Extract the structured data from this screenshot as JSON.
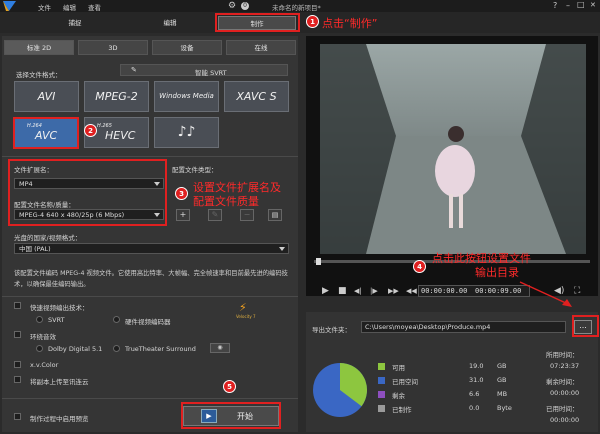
{
  "menu": {
    "file": "文件",
    "edit": "编辑",
    "view": "查看"
  },
  "window": {
    "title": "未命名的新项目*",
    "help": "?",
    "minimize": "–",
    "maximize": "□",
    "close": "✕"
  },
  "modes": {
    "capture": "捕捉",
    "edit": "编辑",
    "produce": "制作"
  },
  "subtabs": {
    "standard2d": "标准 2D",
    "threed": "3D",
    "device": "设备",
    "online": "在线"
  },
  "format_section": {
    "label": "选择文件格式：",
    "smart_svrt": "智能 SVRT"
  },
  "formats": {
    "avi": "AVI",
    "mpeg2": "MPEG-2",
    "wmv": "Windows Media",
    "xavc": "XAVC S",
    "avc_top": "H.264",
    "avc": "AVC",
    "hevc_top": "H.265",
    "hevc": "HEVC",
    "audio": "♪♪"
  },
  "settings": {
    "ext_label": "文件扩展名：",
    "ext_value": "MP4",
    "profile_label": "配置文件名称/质量：",
    "profile_value": "MPEG-4 640 x 480/25p (6 Mbps)",
    "profile_type_label": "配置文件类型：",
    "plus": "+",
    "region_label": "光盘的国家/视频格式：",
    "region_value": "中国 (PAL)",
    "desc": "该配置文件编码 MPEG-4 视频文件。它使用高比特率、大帧幅、完全帧速率和目前最先进的编码技术，以确保最佳编码输出。"
  },
  "encode": {
    "fast_label": "快速视频编出技术：",
    "svrt": "SVRT",
    "hw": "硬件视频编码器",
    "surround_label": "环绕音效",
    "dolby": "Dolby Digital 5.1",
    "truetheater": "TrueTheater Surround",
    "xvcolor": "x.v.Color",
    "upload": "将副本上传至讯连云",
    "preview_during": "制作过程中启用预览",
    "velocity": "Velocity 7"
  },
  "start_label": "开始",
  "player": {
    "time_current": "00:00:00.00",
    "time_total": "00:00:09.00"
  },
  "output": {
    "folder_label": "导出文件夹：",
    "path": "C:\\Users\\moyea\\Desktop\\Produce.mp4",
    "browse": "...",
    "disk": [
      {
        "label": "可用",
        "value": "19.0",
        "unit": "GB",
        "color": "#8dc63f"
      },
      {
        "label": "已用空间",
        "value": "31.0",
        "unit": "GB",
        "color": "#3a67c4"
      },
      {
        "label": "剩余",
        "value": "6.6",
        "unit": "MB",
        "color": "#8e4fbf"
      },
      {
        "label": "已制作",
        "value": "0.0",
        "unit": "Byte",
        "color": "#9a9a9a"
      }
    ],
    "time_used_label": "所用时间：",
    "time_used": "07:23:37",
    "time_left_label": "剩余时间：",
    "time_left": "00:00:00",
    "time_elapsed_label": "已用时间：",
    "time_elapsed": "00:00:00"
  },
  "annotations": {
    "n1": "1",
    "t1": "点击“制作”",
    "n2": "2",
    "n3": "3",
    "t3a": "设置文件扩展名及",
    "t3b": "配置文件质量",
    "n4": "4",
    "t4a": "点击此按钮设置文件",
    "t4b": "输出目录",
    "n5": "5"
  }
}
